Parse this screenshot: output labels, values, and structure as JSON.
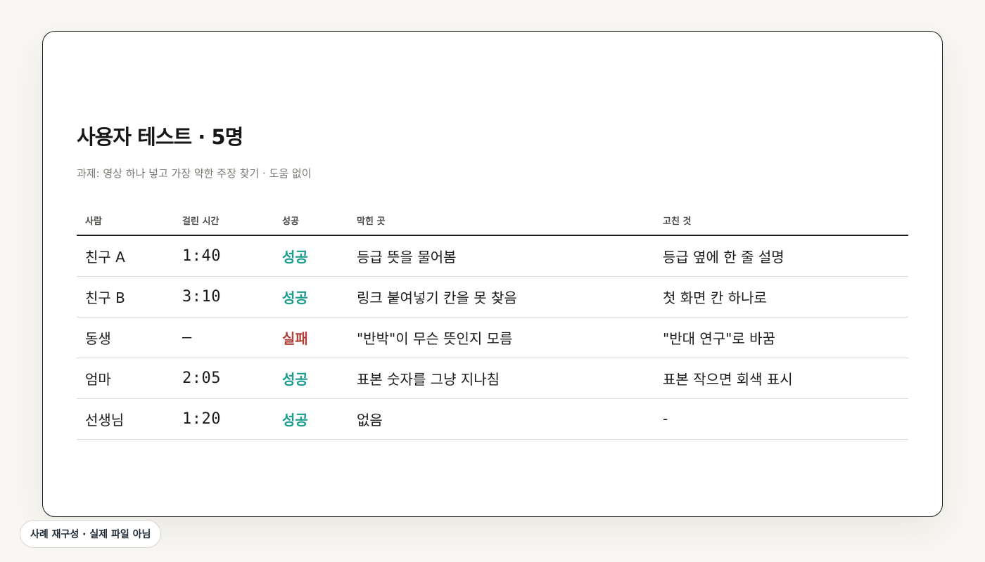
{
  "card": {
    "title": "사용자 테스트 · 5명",
    "subtitle": "과제: 영상 하나 넣고 가장 약한 주장 찾기 · 도움 없이"
  },
  "table": {
    "headers": [
      "사람",
      "걸린 시간",
      "성공",
      "막힌 곳",
      "고친 것"
    ],
    "rows": [
      {
        "person": "친구 A",
        "time": "1:40",
        "result": "성공",
        "result_status": "success",
        "stuck": "등급 뜻을 물어봄",
        "fix": "등급 옆에 한 줄 설명"
      },
      {
        "person": "친구 B",
        "time": "3:10",
        "result": "성공",
        "result_status": "success",
        "stuck": "링크 붙여넣기 칸을 못 찾음",
        "fix": "첫 화면 칸 하나로"
      },
      {
        "person": "동생",
        "time": "—",
        "result": "실패",
        "result_status": "fail",
        "stuck": "\"반박\"이 무슨 뜻인지 모름",
        "fix": "\"반대 연구\"로 바꿈"
      },
      {
        "person": "엄마",
        "time": "2:05",
        "result": "성공",
        "result_status": "success",
        "stuck": "표본 숫자를 그냥 지나침",
        "fix": "표본 작으면 회색 표시"
      },
      {
        "person": "선생님",
        "time": "1:20",
        "result": "성공",
        "result_status": "success",
        "stuck": "없음",
        "fix": "-"
      }
    ]
  },
  "footer_tag": "사례 재구성 · 실제 파일 아님",
  "colors": {
    "success": "#1b9a8e",
    "fail": "#b0403a",
    "background": "#f8f7f3",
    "card": "#ffffff"
  }
}
